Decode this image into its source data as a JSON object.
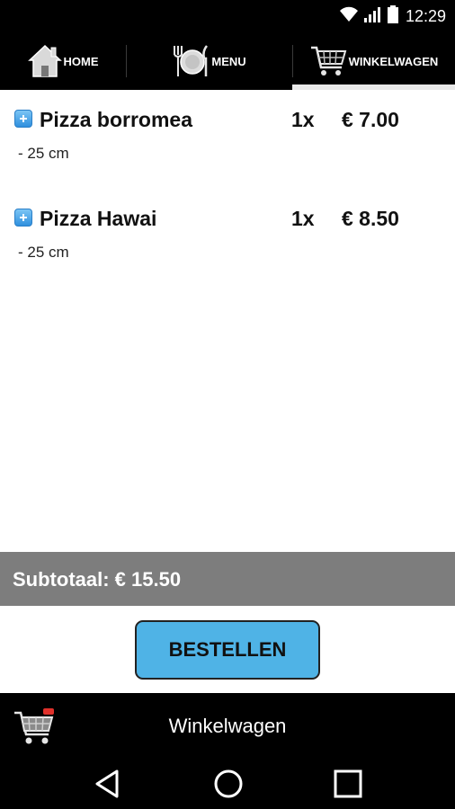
{
  "status_bar": {
    "time": "12:29",
    "icons": [
      "wifi-icon",
      "signal-icon",
      "battery-icon"
    ]
  },
  "tabs": [
    {
      "label": "HOME",
      "icon": "home-icon",
      "active": false
    },
    {
      "label": "MENU",
      "icon": "plate-icon",
      "active": false
    },
    {
      "label": "WINKELWAGEN",
      "icon": "cart-icon",
      "active": true
    }
  ],
  "cart": {
    "items": [
      {
        "name": "Pizza borromea",
        "qty": "1x",
        "price": "€ 7.00",
        "option": "- 25 cm"
      },
      {
        "name": "Pizza Hawai",
        "qty": "1x",
        "price": "€ 8.50",
        "option": "- 25 cm"
      }
    ],
    "subtotal": "Subtotaal: € 15.50",
    "order_button": "BESTELLEN"
  },
  "footer": {
    "title": "Winkelwagen",
    "icon": "cart-icon"
  },
  "system_nav": [
    "back-icon",
    "home-circle-icon",
    "recents-icon"
  ],
  "colors": {
    "accent_button": "#4fb3e6",
    "subtotal_bar": "#7d7d7d",
    "header": "#000000"
  }
}
